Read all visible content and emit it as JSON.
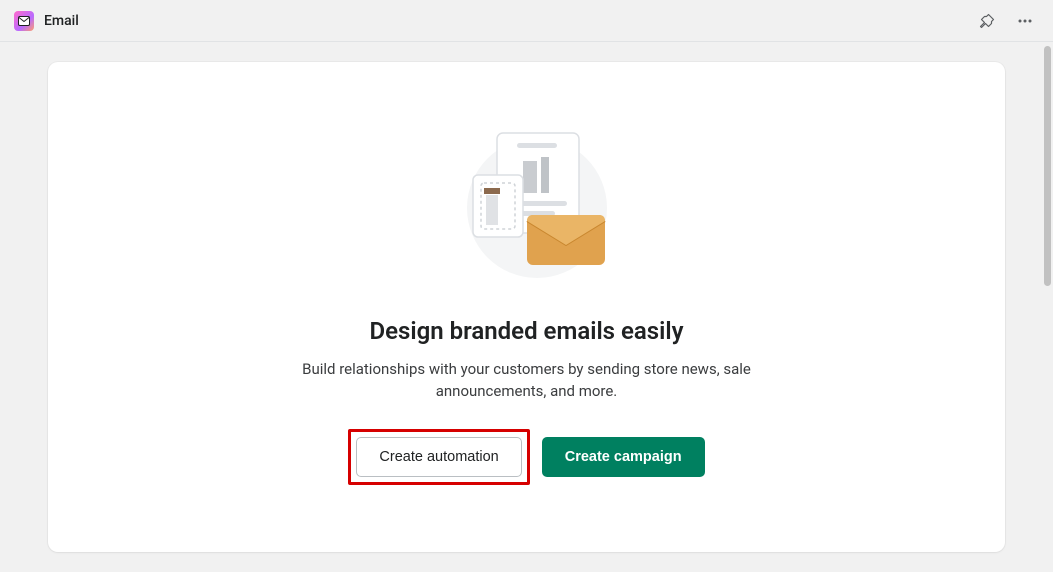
{
  "header": {
    "app_title": "Email"
  },
  "main": {
    "title": "Design branded emails easily",
    "subtitle": "Build relationships with your customers by sending store news, sale announcements, and more.",
    "buttons": {
      "automation": "Create automation",
      "campaign": "Create campaign"
    }
  }
}
